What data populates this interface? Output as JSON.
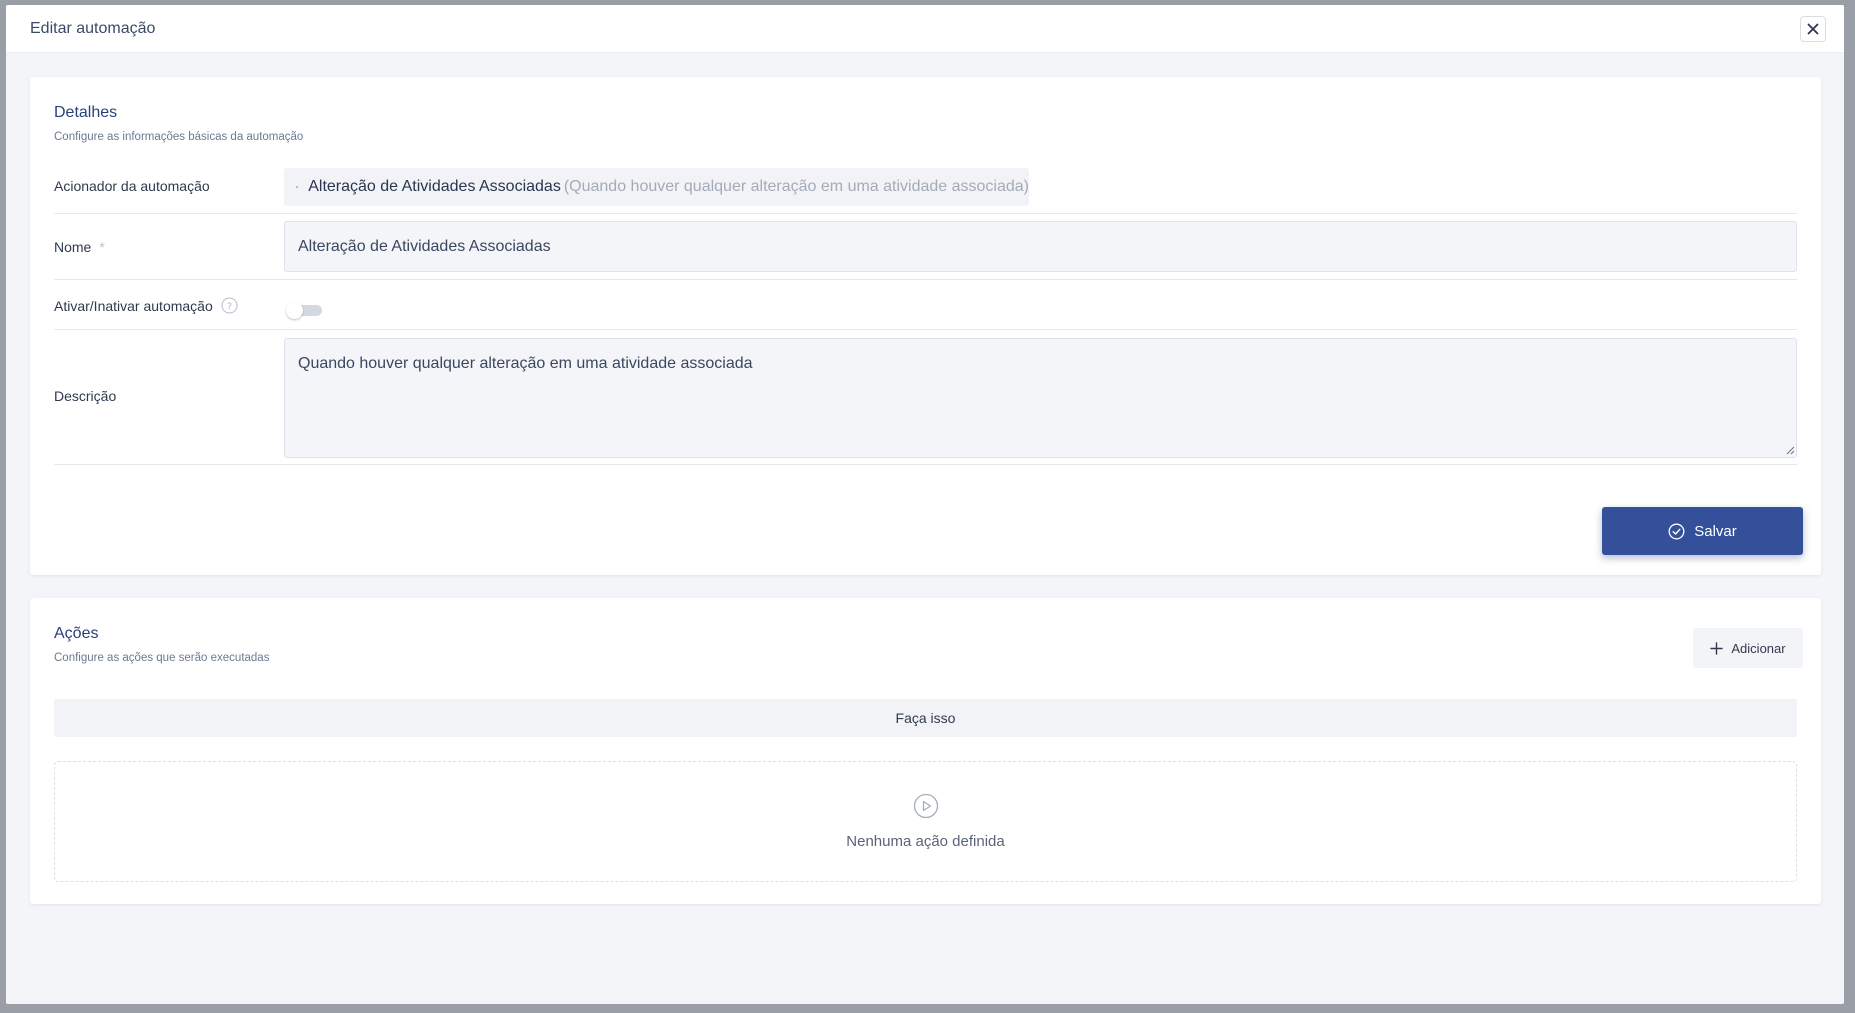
{
  "modal": {
    "title": "Editar automação"
  },
  "details": {
    "title": "Detalhes",
    "subtitle": "Configure as informações básicas da automação",
    "trigger_label": "Acionador da automação",
    "trigger_name": "Alteração de Atividades Associadas",
    "trigger_description": "(Quando houver qualquer alteração em uma atividade associada)",
    "name_label": "Nome",
    "name_required_mark": "*",
    "name_value": "Alteração de Atividades Associadas",
    "toggle_label": "Ativar/Inativar automação",
    "toggle_on": false,
    "description_label": "Descrição",
    "description_value": "Quando houver qualquer alteração em uma atividade associada",
    "save_label": "Salvar"
  },
  "actions": {
    "title": "Ações",
    "subtitle": "Configure as ações que serão executadas",
    "add_label": "Adicionar",
    "do_this_label": "Faça isso",
    "empty_text": "Nenhuma ação definida"
  },
  "colors": {
    "primary": "#35509a",
    "title": "#2c3f7a"
  },
  "icons": {
    "close": "close-icon",
    "edit": "edit-icon",
    "help": "help-icon",
    "check": "check-circle-icon",
    "plus": "plus-icon",
    "play": "play-circle-icon"
  }
}
